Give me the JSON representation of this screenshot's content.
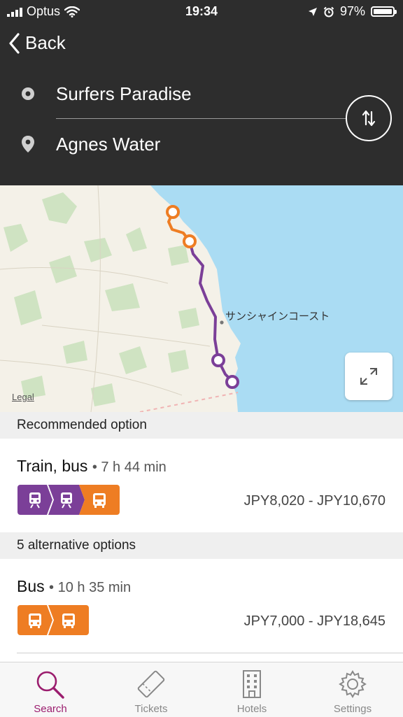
{
  "status": {
    "carrier": "Optus",
    "time": "19:34",
    "battery": "97%",
    "battery_level": 0.97
  },
  "nav": {
    "back_label": "Back"
  },
  "route": {
    "origin": "Surfers Paradise",
    "destination": "Agnes Water"
  },
  "map": {
    "place_label": "サンシャインコースト",
    "legal_label": "Legal"
  },
  "recommended": {
    "section_label": "Recommended option",
    "title": "Train, bus",
    "duration": "• 7 h 44 min",
    "price": "JPY8,020 - JPY10,670",
    "modes": [
      "train-icon",
      "train-icon",
      "bus-icon"
    ]
  },
  "alternatives": {
    "section_label": "5 alternative options",
    "items": [
      {
        "title": "Bus",
        "duration": "• 10 h 35 min",
        "price": "JPY7,000 - JPY18,645",
        "modes": [
          "bus-icon",
          "bus-icon"
        ]
      }
    ]
  },
  "tabs": [
    {
      "label": "Search",
      "icon": "search-icon",
      "active": true
    },
    {
      "label": "Tickets",
      "icon": "ticket-icon",
      "active": false
    },
    {
      "label": "Hotels",
      "icon": "hotel-icon",
      "active": false
    },
    {
      "label": "Settings",
      "icon": "gear-icon",
      "active": false
    }
  ],
  "colors": {
    "header": "#2d2d2d",
    "train": "#7b3f98",
    "bus": "#ee7d23",
    "accent": "#9b1d6e",
    "water": "#aadcf3",
    "land": "#f4f1e8"
  }
}
